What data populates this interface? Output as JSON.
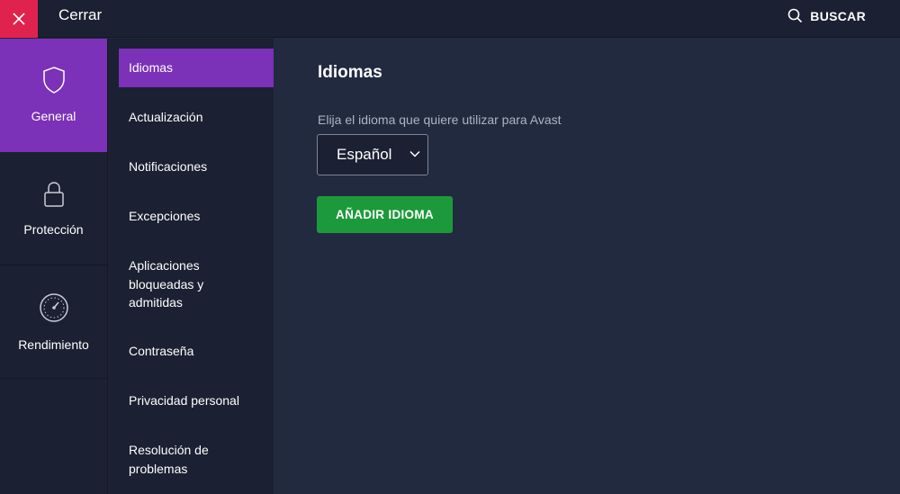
{
  "topbar": {
    "close_label": "Cerrar",
    "search_label": "BUSCAR"
  },
  "categories": [
    {
      "label": "General",
      "icon": "shield-icon",
      "active": true
    },
    {
      "label": "Protección",
      "icon": "lock-icon",
      "active": false
    },
    {
      "label": "Rendimiento",
      "icon": "speedometer-icon",
      "active": false
    }
  ],
  "subnav": [
    {
      "label": "Idiomas",
      "active": true
    },
    {
      "label": "Actualización",
      "active": false
    },
    {
      "label": "Notificaciones",
      "active": false
    },
    {
      "label": "Excepciones",
      "active": false
    },
    {
      "label": "Aplicaciones bloqueadas y admitidas",
      "active": false
    },
    {
      "label": "Contraseña",
      "active": false
    },
    {
      "label": "Privacidad personal",
      "active": false
    },
    {
      "label": "Resolución de problemas",
      "active": false
    }
  ],
  "main": {
    "title": "Idiomas",
    "description": "Elija el idioma que quiere utilizar para Avast",
    "language_select_value": "Español",
    "add_button_label": "AÑADIR IDIOMA"
  },
  "colors": {
    "accent_purple": "#7b31b8",
    "close_red": "#e0224f",
    "button_green": "#1c9a3b",
    "sidebar_bg": "#1b2032",
    "main_bg": "#222a3f"
  }
}
